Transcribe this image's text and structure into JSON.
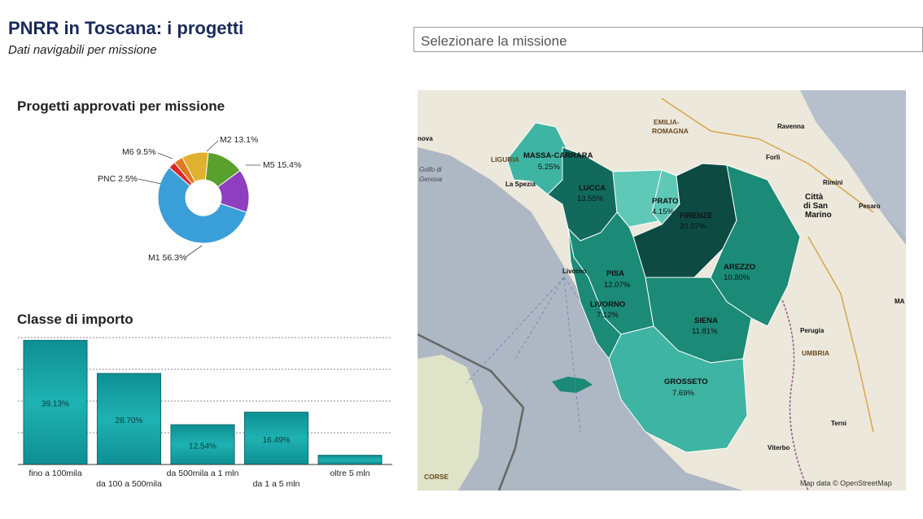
{
  "header": {
    "title": "PNRR in Toscana: i progetti",
    "subtitle": "Dati navigabili per missione"
  },
  "filter": {
    "selected_value": "Selezionare la missione"
  },
  "pie_section": {
    "title": "Progetti approvati per missione"
  },
  "bar_section": {
    "title": "Classe di importo"
  },
  "chart_data": [
    {
      "type": "pie",
      "title": "Progetti approvati per missione",
      "labels": [
        "M1",
        "M2",
        "M5",
        "M6",
        "PNC"
      ],
      "display_labels": [
        "M1 56.3%",
        "M2 13.1%",
        "M5 15.4%",
        "M6 9.5%",
        "PNC 2.5%"
      ],
      "values": [
        56.3,
        13.1,
        15.4,
        9.5,
        2.5
      ],
      "colors": [
        "#3a9fd8",
        "#5aa02c",
        "#8e3fc0",
        "#e0b030",
        "#d62a2a"
      ],
      "extra_colors": [
        "#e07a20"
      ],
      "donut": true
    },
    {
      "type": "bar",
      "title": "Classe di importo",
      "categories": [
        "fino a 100mila",
        "da 100 a 500mila",
        "da 500mila a 1 mln",
        "da 1 a 5 mln",
        "oltre 5 mln"
      ],
      "values": [
        39.13,
        28.7,
        12.54,
        16.49,
        2.9
      ],
      "value_labels": [
        "39.13%",
        "28.70%",
        "12.54%",
        "16.49%",
        ""
      ],
      "ylim": [
        0,
        40
      ],
      "grid": true,
      "color": "#1a9fa0"
    }
  ],
  "map": {
    "provinces": [
      {
        "name": "MASSA-CARRARA",
        "pct": "5.25%"
      },
      {
        "name": "LUCCA",
        "pct": "13.55%"
      },
      {
        "name": "PRATO",
        "pct": "4.15%"
      },
      {
        "name": "FIRENZE",
        "pct": "20.07%"
      },
      {
        "name": "PISA",
        "pct": "12.07%"
      },
      {
        "name": "AREZZO",
        "pct": "10.80%"
      },
      {
        "name": "LIVORNO",
        "pct": "7.12%"
      },
      {
        "name": "SIENA",
        "pct": "11.81%"
      },
      {
        "name": "GROSSETO",
        "pct": "7.69%"
      }
    ],
    "colors": {
      "dark": "#0c4a42",
      "mid_dark": "#116a5c",
      "mid": "#1b8a76",
      "light": "#3eb4a2",
      "lighter": "#5fc8b6",
      "sea": "#aeb8c4",
      "land": "#ede8dc"
    },
    "places": [
      "EMILIA-",
      "ROMAGNA",
      "LIGURIA",
      "UMBRIA",
      "CORSE",
      "Ravenna",
      "Forlì",
      "Rimini",
      "Città",
      "di San",
      "Marino",
      "Pesaro",
      "Perugia",
      "Terni",
      "Viterbo",
      "La Spezia",
      "Livorno",
      "Golfo di",
      "Genova",
      "nova",
      "MA"
    ],
    "attribution": "Map data © OpenStreetMap"
  }
}
